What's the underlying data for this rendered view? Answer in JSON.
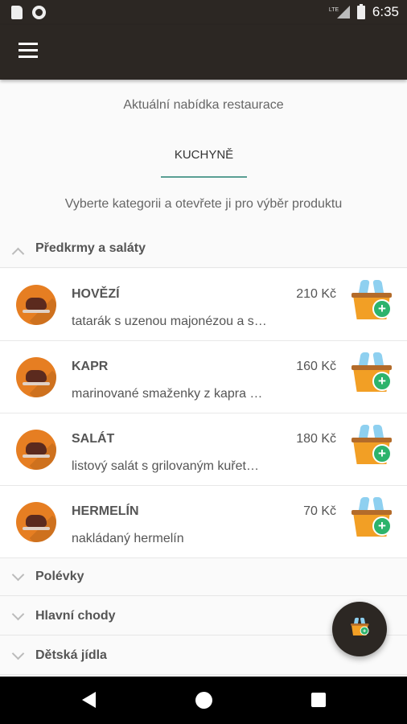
{
  "status_bar": {
    "time": "6:35",
    "network": "LTE"
  },
  "header": {
    "subtitle": "Aktuální nabídka restaurace",
    "tab": "KUCHYNĚ",
    "instruction": "Vyberte kategorii a otevřete ji pro výběr produktu"
  },
  "categories": [
    {
      "label": "Předkrmy a saláty",
      "expanded": true
    },
    {
      "label": "Polévky",
      "expanded": false
    },
    {
      "label": "Hlavní chody",
      "expanded": false
    },
    {
      "label": "Dětská jídla",
      "expanded": false
    }
  ],
  "items": [
    {
      "name": "HOVĚZÍ",
      "price": "210 Kč",
      "desc": "tatarák s uzenou majonézou a s…"
    },
    {
      "name": "KAPR",
      "price": "160 Kč",
      "desc": "marinované smaženky z kapra …"
    },
    {
      "name": "SALÁT",
      "price": "180 Kč",
      "desc": "listový salát s grilovaným kuřet…"
    },
    {
      "name": "HERMELÍN",
      "price": "70 Kč",
      "desc": "nakládaný hermelín"
    }
  ],
  "colors": {
    "bar": "#2c2723",
    "accent": "#5a9f94",
    "thumb": "#e67e22",
    "cart_plus": "#2db36c"
  },
  "icons": {
    "menu": "hamburger-icon",
    "cart": "add-to-cart-icon",
    "fab": "cart-icon"
  }
}
